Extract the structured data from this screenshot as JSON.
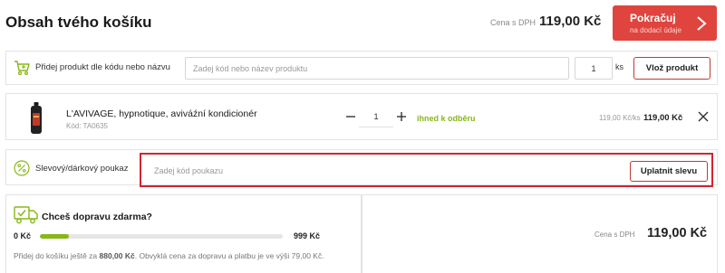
{
  "header": {
    "title": "Obsah tvého košíku",
    "vat_label": "Cena s DPH",
    "total": "119,00 Kč",
    "continue_button": {
      "label": "Pokračuj",
      "sublabel": "na dodací údaje",
      "color": "#e0443e"
    }
  },
  "add_by_code": {
    "label": "Přidej produkt dle kódu nebo názvu",
    "input_placeholder": "Zadej kód nebo název produktu",
    "quantity": "1",
    "quantity_unit": "ks",
    "button_label": "Vlož produkt",
    "icon": "cart-add-icon"
  },
  "cart_items": [
    {
      "name": "L'AVIVAGE, hypnotique, aviváźní kondicionér",
      "code": "Kód: TA0635",
      "quantity": "1",
      "availability": "ihned k odběru",
      "unit_price": "119,00 Kč/ks",
      "total": "119,00 Kč"
    }
  ],
  "voucher": {
    "label": "Slevový/dárkový poukaz",
    "input_placeholder": "Zadej kód poukazu",
    "button_label": "Uplatnit slevu",
    "icon": "percent-icon",
    "highlight_color": "#d32431"
  },
  "free_shipping": {
    "title": "Chceš dopravu zdarma?",
    "start_label": "0 Kč",
    "end_label": "999 Kč",
    "progress_fraction": 0.12,
    "note_before": "Přidej do košíku ještě za",
    "note_amount": "880,00 Kč",
    "note_after": ". Obvyklá cena za dopravu a platbu je ve výši 79,00 Kč.",
    "icon": "truck-check-icon",
    "accent_color": "#86b817"
  },
  "summary": {
    "vat_label": "Cena s DPH",
    "total": "119,00 Kč"
  }
}
